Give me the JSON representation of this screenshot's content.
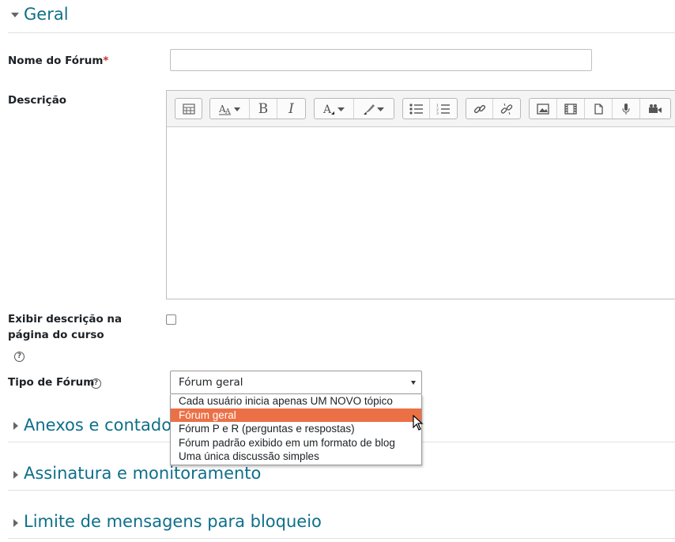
{
  "sections": {
    "geral": "Geral",
    "anexos": "Anexos e contador",
    "assinatura": "Assinatura e monitoramento",
    "limite": "Limite de mensagens para bloqueio"
  },
  "fields": {
    "nome_label": "Nome do Fórum",
    "required_mark": "*",
    "nome_value": "",
    "descricao_label": "Descrição",
    "exibir_label_line1": "Exibir descrição na",
    "exibir_label_line2": "página do curso",
    "exibir_checked": false,
    "tipo_label": "Tipo de Fórum",
    "help_glyph": "?"
  },
  "editor": {
    "toolbar_icons": [
      "show-more-buttons-icon",
      "paragraph-styles-icon",
      "bold-icon",
      "italic-icon",
      "font-color-icon",
      "background-color-icon",
      "unordered-list-icon",
      "ordered-list-icon",
      "link-icon",
      "unlink-icon",
      "image-icon",
      "media-icon",
      "manage-files-icon",
      "record-audio-icon",
      "record-video-icon"
    ],
    "bold_glyph": "B",
    "italic_glyph": "I",
    "content": ""
  },
  "select": {
    "value": "Fórum geral",
    "options": [
      "Cada usuário inicia apenas UM NOVO tópico",
      "Fórum geral",
      "Fórum P e R (perguntas e respostas)",
      "Fórum padrão exibido em um formato de blog",
      "Uma única discussão simples"
    ],
    "highlighted_index": 1
  },
  "colors": {
    "section_title": "#0f6f8a",
    "highlight": "#ec7046",
    "required": "#c9302c"
  }
}
